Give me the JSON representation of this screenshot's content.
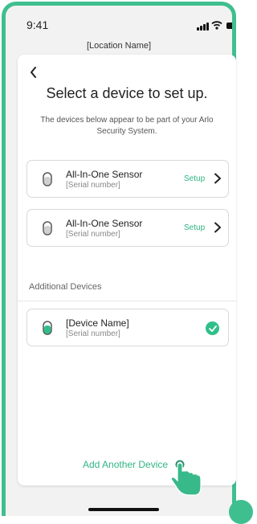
{
  "status_bar": {
    "time": "9:41"
  },
  "header": {
    "location": "[Location Name]"
  },
  "page": {
    "title": "Select a device to set up.",
    "subtitle": "The devices below appear to be part of your Arlo Security System."
  },
  "devices": [
    {
      "name": "All-In-One Sensor",
      "serial": "[Serial number]",
      "action": "Setup"
    },
    {
      "name": "All-In-One Sensor",
      "serial": "[Serial number]",
      "action": "Setup"
    }
  ],
  "additional": {
    "label": "Additional Devices",
    "devices": [
      {
        "name": "[Device Name]",
        "serial": "[Serial number]",
        "status": "complete"
      }
    ]
  },
  "footer": {
    "add_link": "Add Another Device"
  },
  "colors": {
    "accent": "#2fb583",
    "frame": "#3fbf8f",
    "check": "#2fc08a"
  },
  "icons": [
    "back-chevron-icon",
    "sensor-icon",
    "chevron-right-icon",
    "checkmark-icon",
    "hand-pointer-icon"
  ]
}
